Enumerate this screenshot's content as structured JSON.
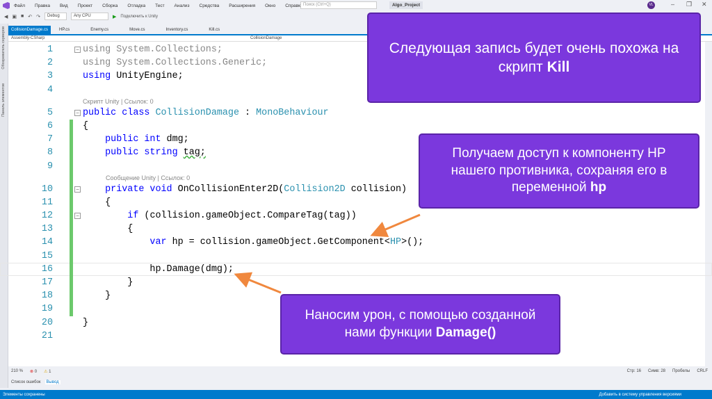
{
  "window": {
    "title": "Algo_Project",
    "search_placeholder": "Поиск (Ctrl+Q)",
    "avatar": "VL"
  },
  "menu": [
    "Файл",
    "Правка",
    "Вид",
    "Проект",
    "Сборка",
    "Отладка",
    "Тест",
    "Анализ",
    "Средства",
    "Расширения",
    "Окно",
    "Справка"
  ],
  "toolbar": {
    "config": "Debug",
    "platform": "Any CPU",
    "run": "Подключить к Unity"
  },
  "side_panels": [
    "Обозреватель серверов",
    "Панель элементов"
  ],
  "tabs": [
    "CollisionDamage.cs",
    "HP.cs",
    "Enemy.cs",
    "Move.cs",
    "Inventory.cs",
    "Kill.cs"
  ],
  "navbar": {
    "project": "Assembly-CSharp",
    "class": "CollisionDamage"
  },
  "lens": {
    "script": "Скрипт Unity | Ссылок: 0",
    "message": "Сообщение Unity | Ссылок: 0"
  },
  "code": {
    "l1a": "using ",
    "l1b": "System.Collections;",
    "l2a": "using ",
    "l2b": "System.Collections.Generic;",
    "l3a": "using ",
    "l3b": "UnityEngine;",
    "l5a": "public class ",
    "l5b": "CollisionDamage",
    " l5c": "",
    "l5d": " : ",
    "l5e": "MonoBehaviour",
    "l6": "{",
    "l7a": "    public int ",
    "l7b": "dmg;",
    "l8a": "    public string ",
    "l8b": "tag;",
    "l10a": "    private void ",
    "l10b": "OnCollisionEnter2D(",
    "l10c": "Collision2D",
    "l10d": " collision)",
    "l11": "    {",
    "l12a": "        if ",
    "l12b": "(collision.gameObject.CompareTag(tag))",
    "l13": "        {",
    "l14a": "            var ",
    "l14b": "hp = collision.gameObject.GetComponent<",
    "l14c": "HP",
    "l14d": ">();",
    "l16": "            hp.Damage(dmg);",
    "l17": "        }",
    "l18": "    }",
    "l20": "}"
  },
  "editor_status": {
    "zoom": "210 %",
    "errors": "0",
    "warnings": "1",
    "line": "Стр: 16",
    "col": "Симв: 28",
    "spaces": "Пробелы",
    "eol": "CRLF"
  },
  "bottom_tabs": [
    "Список ошибок",
    "Вывод"
  ],
  "statusbar": {
    "left": "Элементы сохранены",
    "right": "Добавить в систему управления версиями"
  },
  "callouts": {
    "c1": "Следующая запись будет очень похожа на скрипт ",
    "c1b": "Kill",
    "c2": "Получаем доступ к компоненту HP нашего противника, сохраняя его в переменной ",
    "c2b": "hp",
    "c3": "Наносим урон, с помощью созданной нами функции ",
    "c3b": "Damage()"
  },
  "colors": {
    "callout": "#7b38dd",
    "arrow": "#f0883e",
    "accent": "#007acc"
  }
}
